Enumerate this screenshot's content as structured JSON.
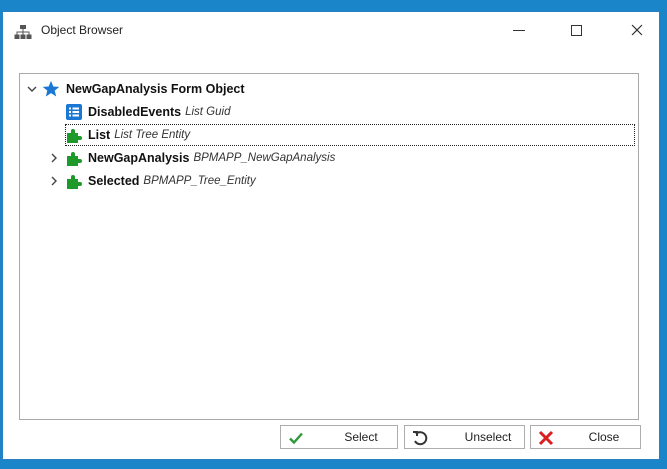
{
  "window": {
    "title": "Object Browser",
    "accent_color": "#1a86c9"
  },
  "tree": {
    "root": {
      "name": "NewGapAnalysis Form Object",
      "icon": "star-icon",
      "expanded": true
    },
    "children": [
      {
        "name": "DisabledEvents",
        "type": "List Guid",
        "icon": "list-icon",
        "expandable": false
      },
      {
        "name": "List",
        "type": "List Tree Entity",
        "icon": "puzzle-icon",
        "expandable": false,
        "focused": true
      },
      {
        "name": "NewGapAnalysis",
        "type": "BPMAPP_NewGapAnalysis",
        "icon": "puzzle-icon",
        "expandable": true
      },
      {
        "name": "Selected",
        "type": "BPMAPP_Tree_Entity",
        "icon": "puzzle-icon",
        "expandable": true
      }
    ]
  },
  "buttons": {
    "select": "Select",
    "unselect": "Unselect",
    "close": "Close"
  }
}
